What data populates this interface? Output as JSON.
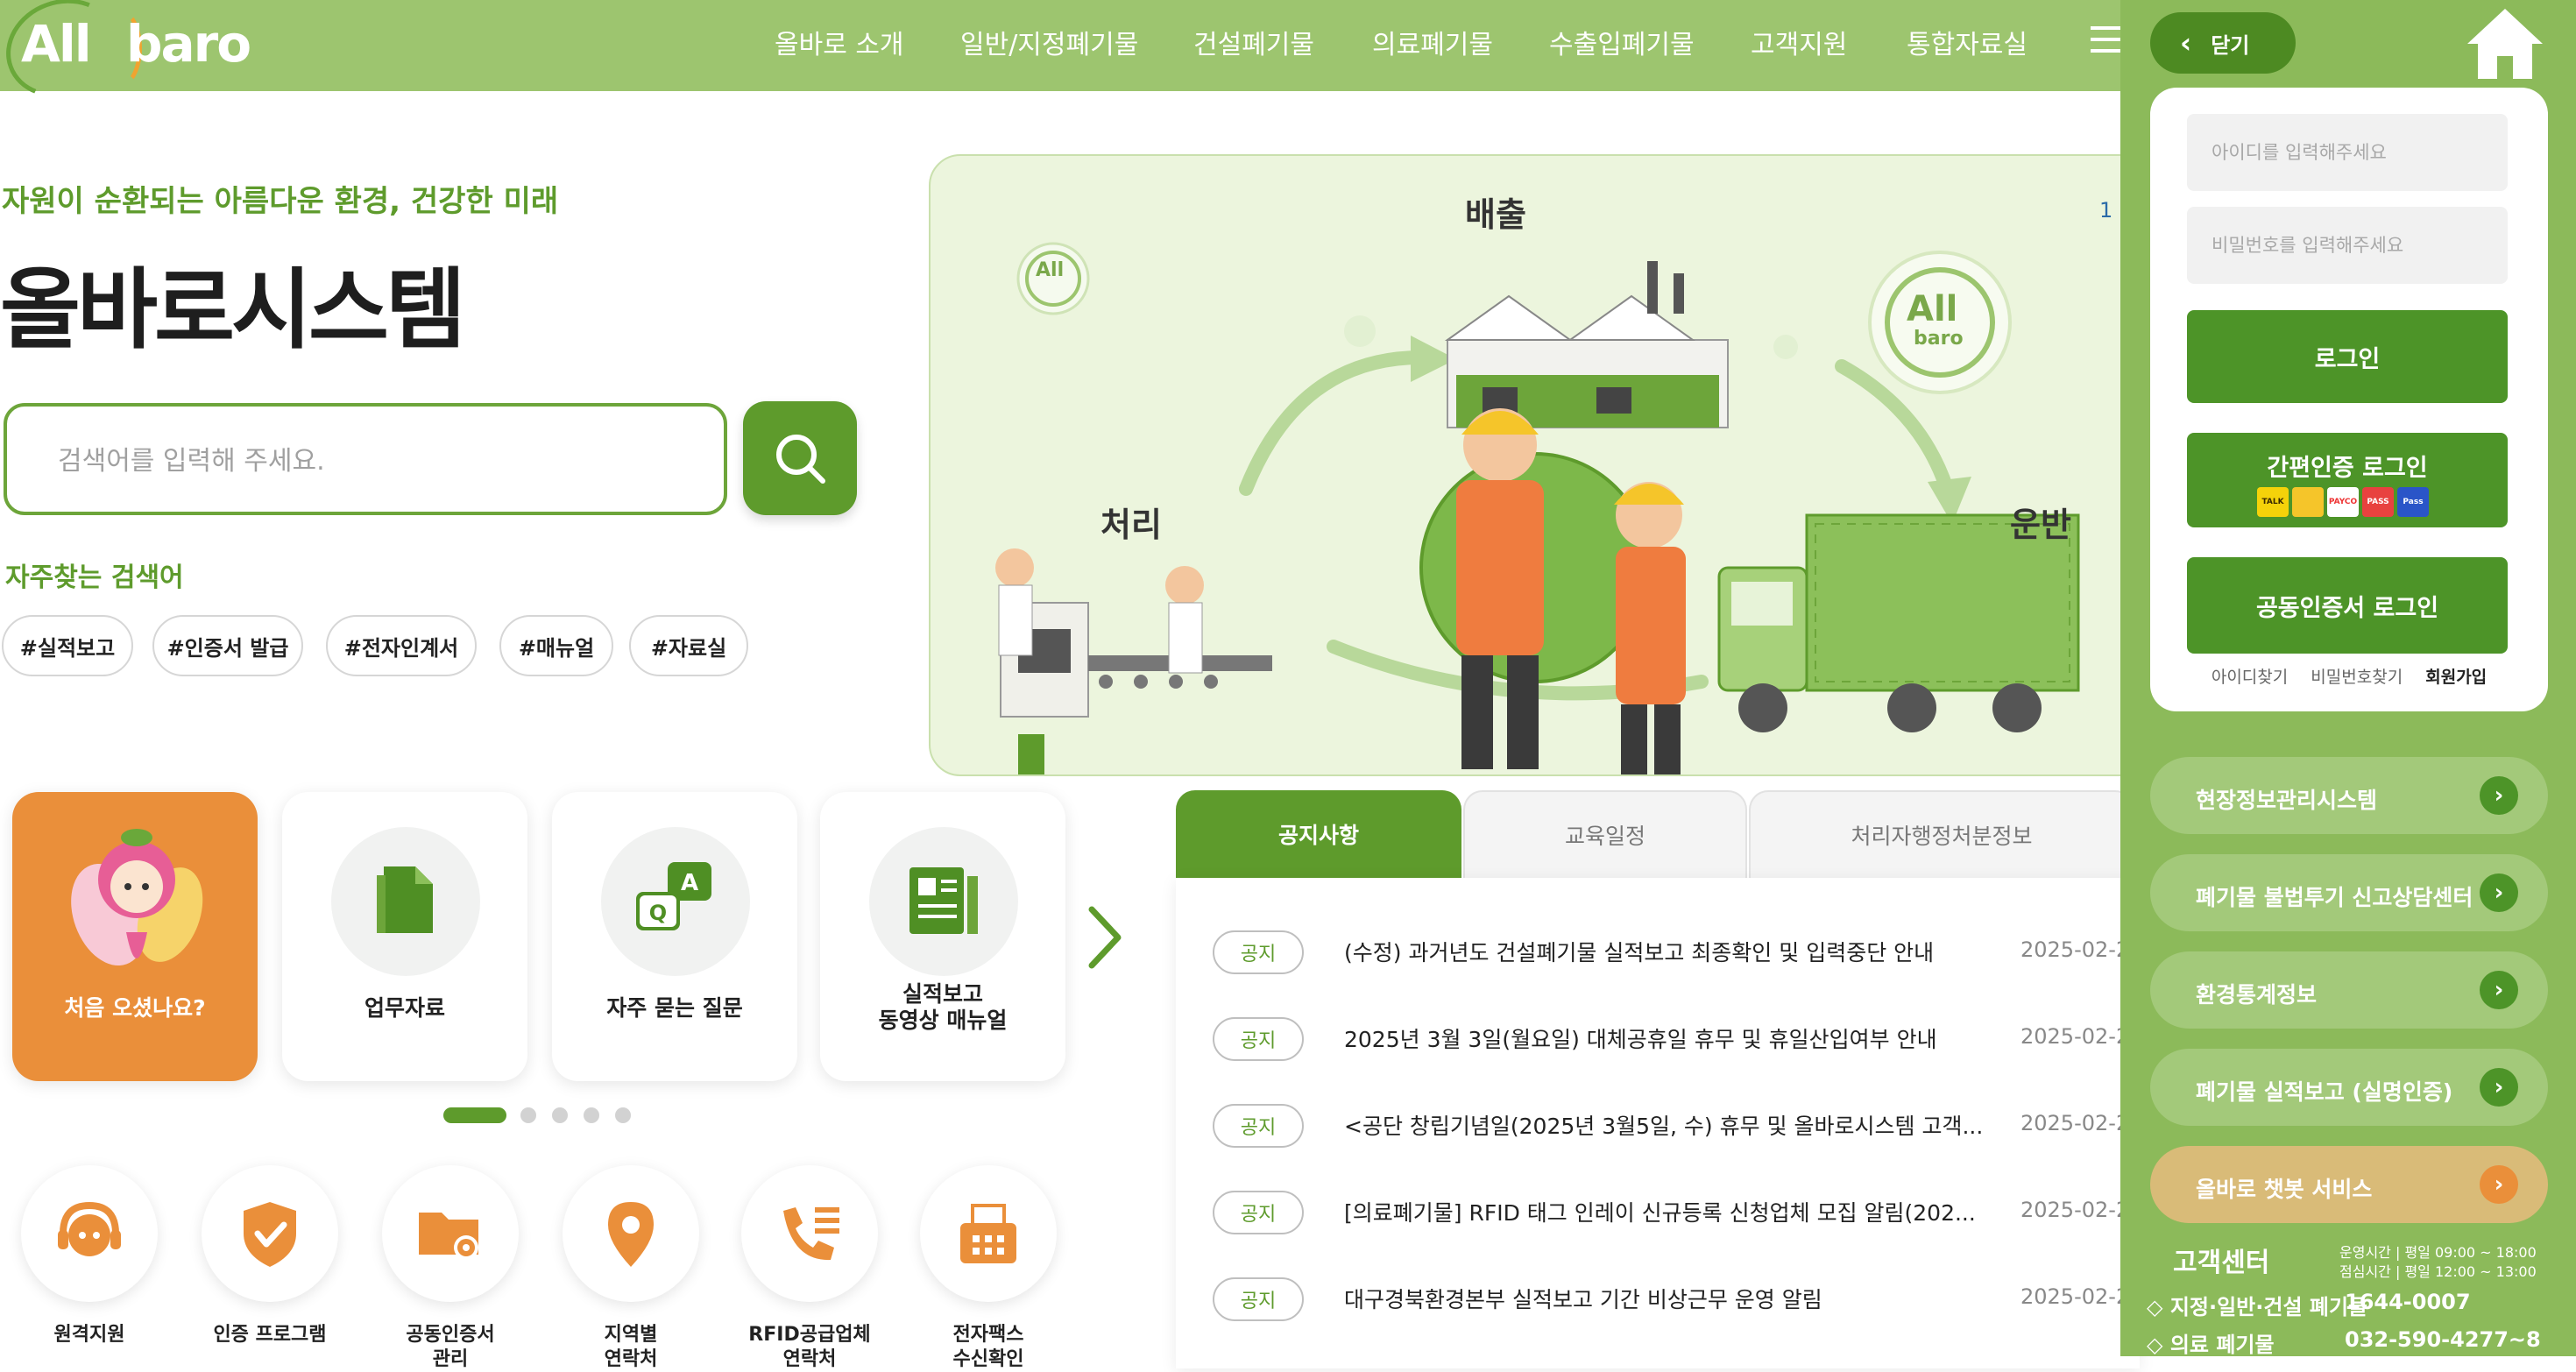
{
  "header": {
    "logo_all": "All",
    "logo_baro": "baro",
    "nav": [
      "올바로 소개",
      "일반/지정폐기물",
      "건설폐기물",
      "의료폐기물",
      "수출입폐기물",
      "고객지원",
      "통합자료실"
    ]
  },
  "hero": {
    "tagline": "자원이 순환되는 아름다운 환경, 건강한 미래",
    "title": "올바로시스템",
    "search_placeholder": "검색어를 입력해 주세요.",
    "frequent_title": "자주찾는 검색어",
    "tags": [
      "#실적보고",
      "#인증서 발급",
      "#전자인계서",
      "#매뉴얼",
      "#자료실"
    ]
  },
  "illustration": {
    "label_emission": "배출",
    "label_processing": "처리",
    "label_transport": "운반",
    "badge_all": "All",
    "badge_baro": "baro",
    "slide_counter": "1"
  },
  "quick_tiles": [
    {
      "label": "처음 오셨나요?",
      "icon": "mascot-icon"
    },
    {
      "label": "업무자료",
      "icon": "document-icon"
    },
    {
      "label": "자주 묻는 질문",
      "icon": "qa-icon"
    },
    {
      "label": "실적보고\n동영상 매뉴얼",
      "icon": "manual-icon"
    }
  ],
  "quick_links": [
    {
      "label": "원격지원",
      "icon": "headset-icon"
    },
    {
      "label": "인증 프로그램",
      "icon": "shield-icon"
    },
    {
      "label": "공동인증서\n관리",
      "icon": "folder-gear-icon"
    },
    {
      "label": "지역별\n연락처",
      "icon": "location-icon"
    },
    {
      "label": "RFID공급업체\n연락처",
      "icon": "phone-list-icon"
    },
    {
      "label": "전자팩스\n수신확인",
      "icon": "fax-icon"
    }
  ],
  "notice": {
    "tabs": [
      "공지사항",
      "교육일정",
      "처리자행정처분정보"
    ],
    "badge": "공지",
    "items": [
      {
        "title": "(수정) 과거년도 건설폐기물 실적보고 최종확인 및 입력중단 안내",
        "date": "2025-02-2"
      },
      {
        "title": "2025년 3월 3일(월요일) 대체공휴일 휴무 및 휴일산입여부 안내",
        "date": "2025-02-2"
      },
      {
        "title": "<공단 창립기념일(2025년 3월5일, 수) 휴무 및 올바로시스템 고객...",
        "date": "2025-02-2"
      },
      {
        "title": "[의료폐기물] RFID 태그 인레이 신규등록 신청업체 모집 알림(202...",
        "date": "2025-02-2"
      },
      {
        "title": "대구경북환경본부 실적보고 기간 비상근무 운영 알림",
        "date": "2025-02-2"
      }
    ]
  },
  "side_panel": {
    "close_label": "닫기",
    "id_placeholder": "아이디를 입력해주세요",
    "pw_placeholder": "비밀번호를 입력해주세요",
    "login_label": "로그인",
    "easy_login_label": "간편인증 로그인",
    "cert_labels": [
      "TALK",
      "",
      "PAYCO",
      "PASS",
      "Pass"
    ],
    "cert_login_label": "공동인증서 로그인",
    "find_id": "아이디찾기",
    "find_pw": "비밀번호찾기",
    "signup": "회원가입",
    "links": [
      "현장정보관리시스템",
      "폐기물 불법투기 신고상담센터",
      "환경통계정보",
      "폐기물 실적보고 (실명인증)",
      "올바로 챗봇 서비스"
    ],
    "cs_title": "고객센터",
    "cs_hours_1": "운영시간  |  평일 09:00 ~ 18:00",
    "cs_hours_2": "점심시간  |  평일 12:00 ~ 13:00",
    "cs_line_1_label": "◇ 지정·일반·건설 폐기물",
    "cs_line_1_num": "1644-0007",
    "cs_line_2_label": "◇ 의료 폐기물",
    "cs_line_2_num": "032-590-4277~8"
  },
  "colors": {
    "header_green": "#9dc56f",
    "primary_green": "#5e9b2c",
    "panel_green": "#8cba5a",
    "accent_orange": "#ea8f3a"
  }
}
